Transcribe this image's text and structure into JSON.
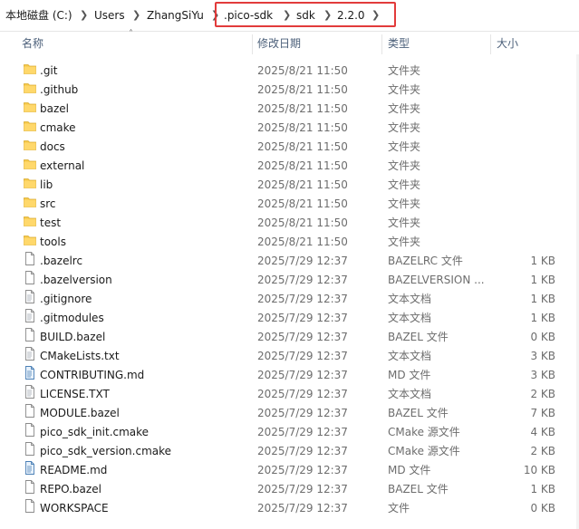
{
  "breadcrumb": [
    {
      "label": "本地磁盘 (C:)"
    },
    {
      "label": "Users"
    },
    {
      "label": "ZhangSiYu"
    },
    {
      "label": ".pico-sdk"
    },
    {
      "label": "sdk"
    },
    {
      "label": "2.2.0"
    }
  ],
  "columns": {
    "name": "名称",
    "date": "修改日期",
    "type": "类型",
    "size": "大小"
  },
  "files": [
    {
      "icon": "folder-icon",
      "name": ".git",
      "date": "2025/8/21 11:50",
      "type": "文件夹",
      "size": ""
    },
    {
      "icon": "folder-icon",
      "name": ".github",
      "date": "2025/8/21 11:50",
      "type": "文件夹",
      "size": ""
    },
    {
      "icon": "folder-icon",
      "name": "bazel",
      "date": "2025/8/21 11:50",
      "type": "文件夹",
      "size": ""
    },
    {
      "icon": "folder-icon",
      "name": "cmake",
      "date": "2025/8/21 11:50",
      "type": "文件夹",
      "size": ""
    },
    {
      "icon": "folder-icon",
      "name": "docs",
      "date": "2025/8/21 11:50",
      "type": "文件夹",
      "size": ""
    },
    {
      "icon": "folder-icon",
      "name": "external",
      "date": "2025/8/21 11:50",
      "type": "文件夹",
      "size": ""
    },
    {
      "icon": "folder-icon",
      "name": "lib",
      "date": "2025/8/21 11:50",
      "type": "文件夹",
      "size": ""
    },
    {
      "icon": "folder-icon",
      "name": "src",
      "date": "2025/8/21 11:50",
      "type": "文件夹",
      "size": ""
    },
    {
      "icon": "folder-icon",
      "name": "test",
      "date": "2025/8/21 11:50",
      "type": "文件夹",
      "size": ""
    },
    {
      "icon": "folder-icon",
      "name": "tools",
      "date": "2025/8/21 11:50",
      "type": "文件夹",
      "size": ""
    },
    {
      "icon": "file-icon",
      "name": ".bazelrc",
      "date": "2025/7/29 12:37",
      "type": "BAZELRC 文件",
      "size": "1 KB"
    },
    {
      "icon": "file-icon",
      "name": ".bazelversion",
      "date": "2025/7/29 12:37",
      "type": "BAZELVERSION ...",
      "size": "1 KB"
    },
    {
      "icon": "text-file-icon",
      "name": ".gitignore",
      "date": "2025/7/29 12:37",
      "type": "文本文档",
      "size": "1 KB"
    },
    {
      "icon": "text-file-icon",
      "name": ".gitmodules",
      "date": "2025/7/29 12:37",
      "type": "文本文档",
      "size": "1 KB"
    },
    {
      "icon": "file-icon",
      "name": "BUILD.bazel",
      "date": "2025/7/29 12:37",
      "type": "BAZEL 文件",
      "size": "0 KB"
    },
    {
      "icon": "text-file-icon",
      "name": "CMakeLists.txt",
      "date": "2025/7/29 12:37",
      "type": "文本文档",
      "size": "3 KB"
    },
    {
      "icon": "markdown-file-icon",
      "name": "CONTRIBUTING.md",
      "date": "2025/7/29 12:37",
      "type": "MD 文件",
      "size": "3 KB"
    },
    {
      "icon": "text-file-icon",
      "name": "LICENSE.TXT",
      "date": "2025/7/29 12:37",
      "type": "文本文档",
      "size": "2 KB"
    },
    {
      "icon": "file-icon",
      "name": "MODULE.bazel",
      "date": "2025/7/29 12:37",
      "type": "BAZEL 文件",
      "size": "7 KB"
    },
    {
      "icon": "file-icon",
      "name": "pico_sdk_init.cmake",
      "date": "2025/7/29 12:37",
      "type": "CMake 源文件",
      "size": "4 KB"
    },
    {
      "icon": "file-icon",
      "name": "pico_sdk_version.cmake",
      "date": "2025/7/29 12:37",
      "type": "CMake 源文件",
      "size": "2 KB"
    },
    {
      "icon": "markdown-file-icon",
      "name": "README.md",
      "date": "2025/7/29 12:37",
      "type": "MD 文件",
      "size": "10 KB"
    },
    {
      "icon": "file-icon",
      "name": "REPO.bazel",
      "date": "2025/7/29 12:37",
      "type": "BAZEL 文件",
      "size": "1 KB"
    },
    {
      "icon": "file-icon",
      "name": "WORKSPACE",
      "date": "2025/7/29 12:37",
      "type": "文件",
      "size": "0 KB"
    }
  ],
  "colors": {
    "highlight": "#e23b3b",
    "folder": "#f6c94a",
    "header_text": "#4c607a"
  }
}
